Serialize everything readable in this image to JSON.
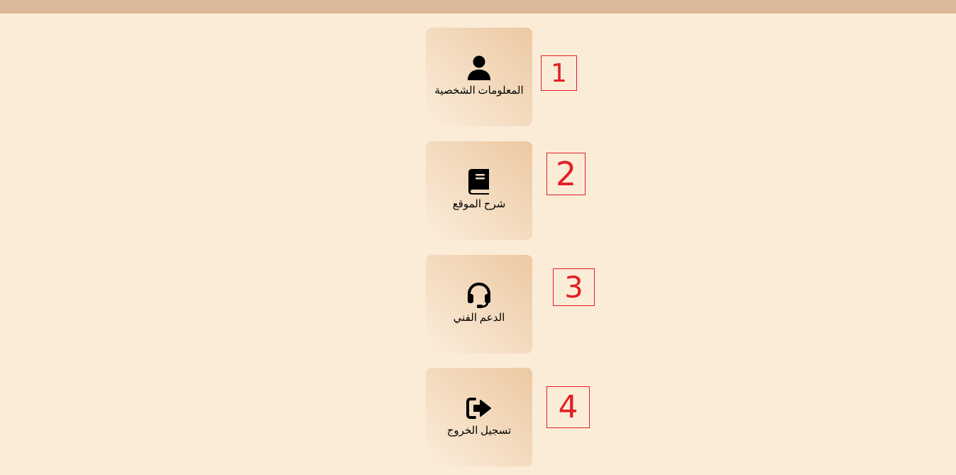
{
  "colors": {
    "background": "#fbecd8",
    "topbar": "#dbb99a",
    "annotation": "#e21f26"
  },
  "menu": {
    "items": [
      {
        "label": "المعلومات الشخصية",
        "icon": "user-icon"
      },
      {
        "label": "شرح الموقع",
        "icon": "book-icon"
      },
      {
        "label": "الدعم الفني",
        "icon": "headset-icon"
      },
      {
        "label": "تسجيل الخروج",
        "icon": "sign-out-icon"
      }
    ]
  },
  "annotations": [
    "1",
    "2",
    "3",
    "4"
  ]
}
